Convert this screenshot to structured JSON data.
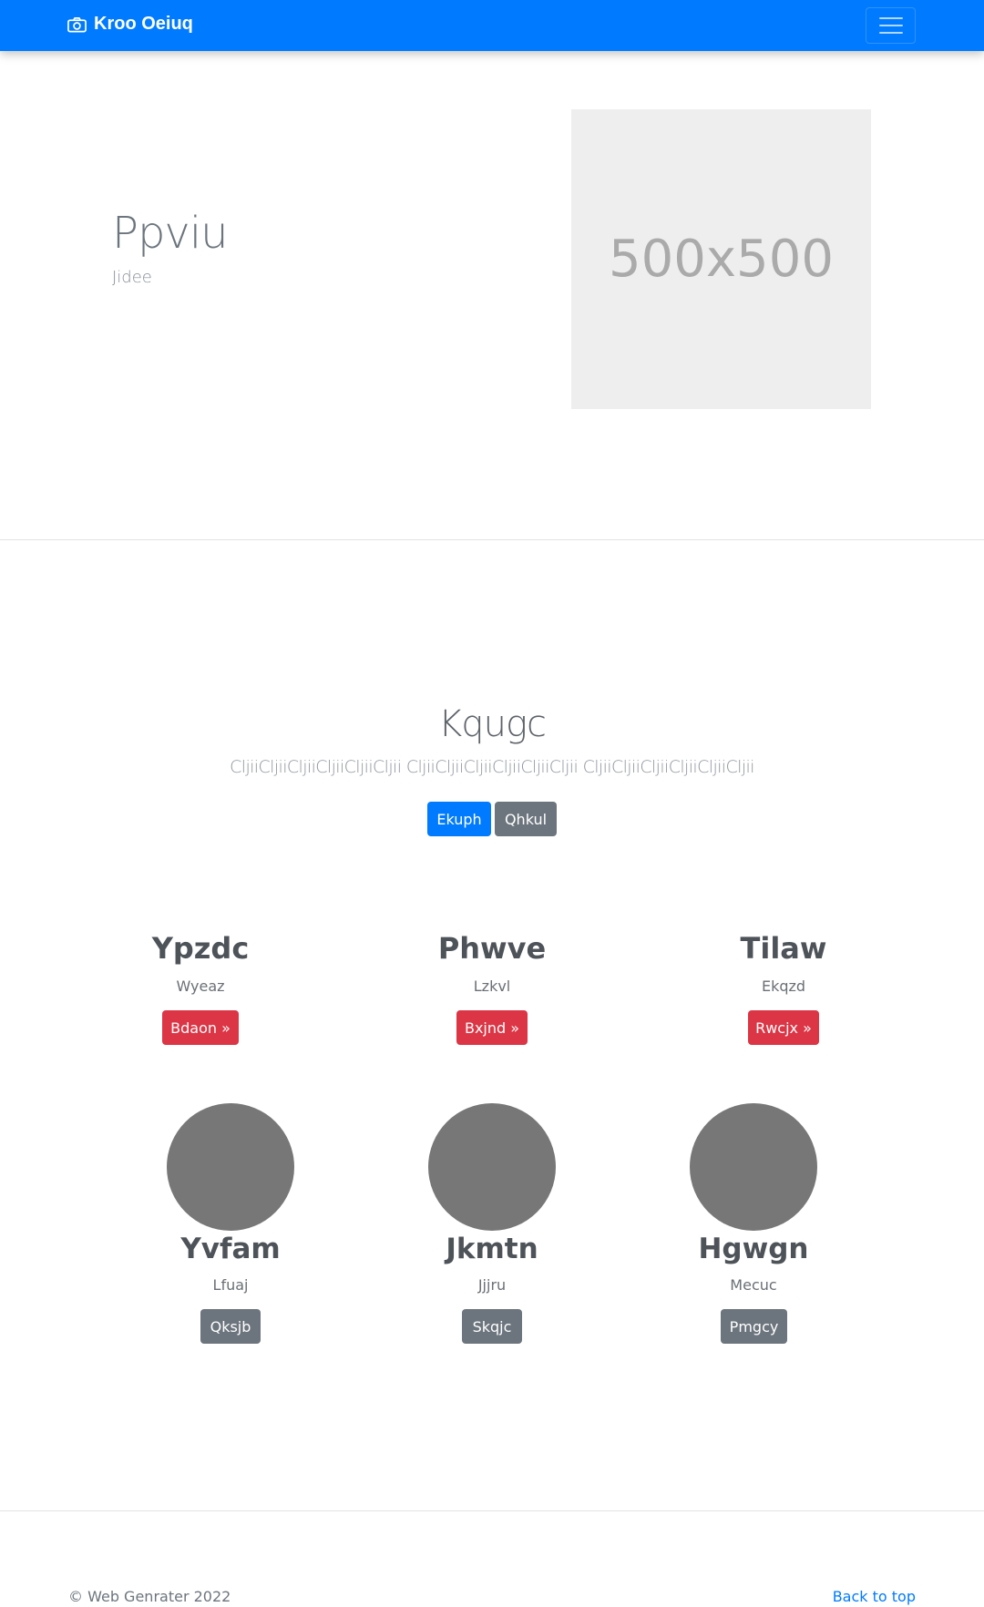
{
  "navbar": {
    "brand": "Kroo Oeiuq",
    "brand_icon": "camera-icon",
    "toggler_icon": "hamburger-icon",
    "background": "#007bff"
  },
  "hero": {
    "title": "Ppviu",
    "subtitle": "Jidee",
    "image_placeholder": "500x500"
  },
  "jumbotron": {
    "title": "Kqugc",
    "lead": "CljiiCljiiCljiiCljiiCljiiCljii CljiiCljiiCljiiCljiiCljiiCljii CljiiCljiiCljiiCljiiCljiiCljii",
    "primary_button": "Ekuph",
    "secondary_button": "Qhkul"
  },
  "features": [
    {
      "title": "Ypzdc",
      "subtitle": "Wyeaz",
      "button": "Bdaon »"
    },
    {
      "title": "Phwve",
      "subtitle": "Lzkvl",
      "button": "Bxjnd »"
    },
    {
      "title": "Tilaw",
      "subtitle": "Ekqzd",
      "button": "Rwcjx »"
    }
  ],
  "team": [
    {
      "name": "Yvfam",
      "role": "Lfuaj",
      "button": "Qksjb"
    },
    {
      "name": "Jkmtn",
      "role": "Jjjru",
      "button": "Skqjc"
    },
    {
      "name": "Hgwgn",
      "role": "Mecuc",
      "button": "Pmgcy"
    }
  ],
  "footer": {
    "copyright": "© Web Genrater 2022",
    "back_to_top": "Back to top"
  },
  "colors": {
    "primary": "#007bff",
    "secondary": "#6c757d",
    "danger": "#dc3545",
    "placeholder_bg": "#eeeeee",
    "avatar": "#777777"
  }
}
